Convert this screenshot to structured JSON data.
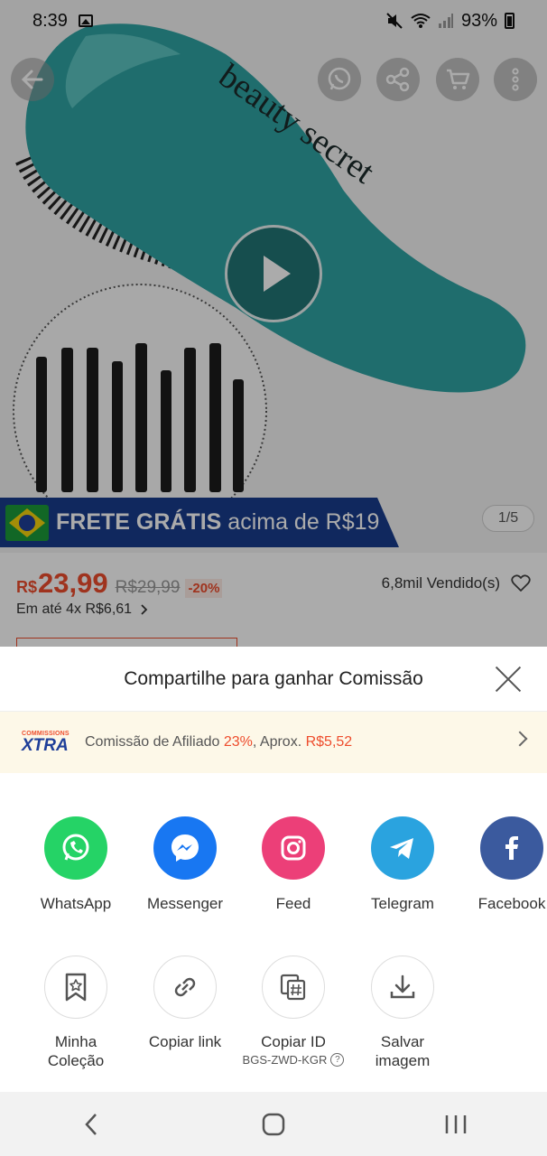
{
  "status_bar": {
    "time": "8:39",
    "battery": "93%"
  },
  "hero": {
    "brand_text": "beauty secret",
    "image_counter": "1/5"
  },
  "promo": {
    "bold_text": "FRETE GRÁTIS",
    "rest_text": " acima de R$19"
  },
  "price": {
    "currency": "R$",
    "current": "23,99",
    "original": "R$29,99",
    "discount": "-20%",
    "sold": "6,8mil Vendido(s)",
    "installments": "Em até 4x R$6,61"
  },
  "share_sheet": {
    "title": "Compartilhe para ganhar Comissão",
    "commission": {
      "badge_small": "COMMISSIONS",
      "badge_big": "XTRA",
      "label": "Comissão de Afiliado ",
      "rate": "23%",
      "middle": ", Aprox. ",
      "amount": "R$5,52"
    },
    "apps": [
      {
        "label": "WhatsApp",
        "icon": "whatsapp-icon",
        "color": "#25d366"
      },
      {
        "label": "Messenger",
        "icon": "messenger-icon",
        "color": "#1877f2"
      },
      {
        "label": "Feed",
        "icon": "instagram-icon",
        "color": "#ec3f78"
      },
      {
        "label": "Telegram",
        "icon": "telegram-icon",
        "color": "#2aa3df"
      },
      {
        "label": "Facebook",
        "icon": "facebook-icon",
        "color": "#3b5a9e"
      }
    ],
    "tools": [
      {
        "label": "Minha\nColeção",
        "icon": "bookmark-star-icon"
      },
      {
        "label": "Copiar link",
        "icon": "link-icon"
      },
      {
        "label": "Copiar ID",
        "sub": "BGS-ZWD-KGR",
        "icon": "copy-id-icon"
      },
      {
        "label": "Salvar\nimagem",
        "icon": "download-icon"
      }
    ]
  }
}
